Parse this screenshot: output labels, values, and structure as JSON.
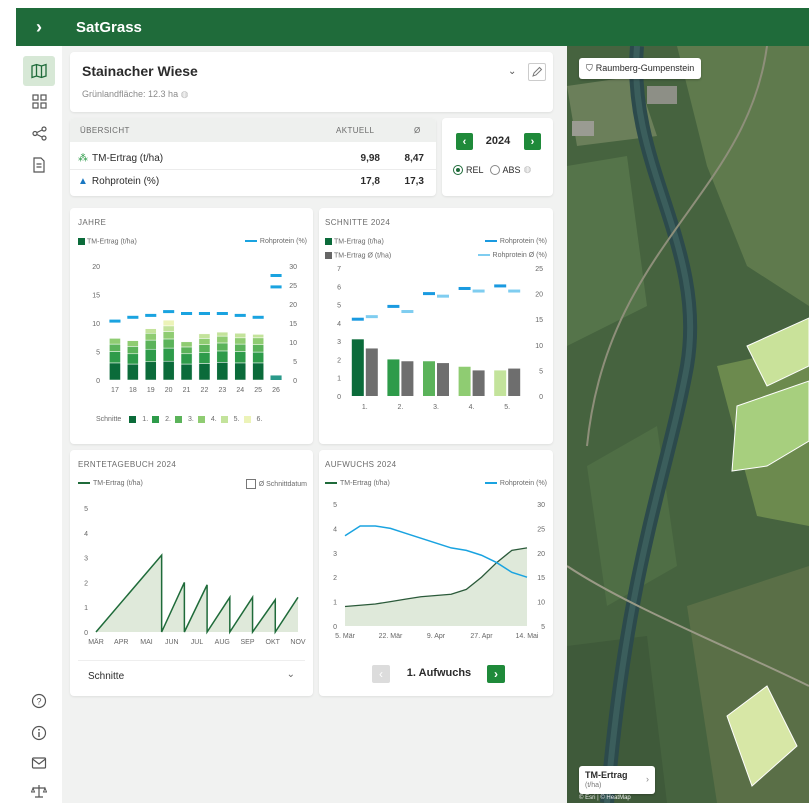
{
  "app": {
    "title": "SatGrass"
  },
  "field": {
    "name": "Stainacher Wiese",
    "area": "Grünlandfläche: 12.3 ha"
  },
  "overview": {
    "title": "ÜBERSICHT",
    "col_current": "AKTUELL",
    "col_avg": "Ø",
    "rows": [
      {
        "label": "TM-Ertrag (t/ha)",
        "current": "9,98",
        "avg": "8,47"
      },
      {
        "label": "Rohprotein (%)",
        "current": "17,8",
        "avg": "17,3"
      }
    ]
  },
  "year_selector": {
    "year": "2024",
    "rel": "REL",
    "abs": "ABS"
  },
  "jahre": {
    "title": "JAHRE",
    "legend_yield": "TM-Ertrag (t/ha)",
    "legend_protein": "Rohprotein (%)",
    "cut_legend_label": "Schnitte",
    "cut_labels": [
      "1.",
      "2.",
      "3.",
      "4.",
      "5.",
      "6."
    ]
  },
  "schnitte": {
    "title": "SCHNITTE 2024",
    "legend_yield": "TM-Ertrag (t/ha)",
    "legend_yield_avg": "TM-Ertrag Ø (t/ha)",
    "legend_protein": "Rohprotein (%)",
    "legend_protein_avg": "Rohprotein Ø (%)"
  },
  "ernte": {
    "title": "ERNTETAGEBUCH 2024",
    "legend_yield": "TM-Ertrag (t/ha)",
    "checkbox_label": "Ø Schnittdatum",
    "dropdown_value": "Schnitte"
  },
  "aufwuchs": {
    "title": "AUFWUCHS 2024",
    "legend_yield": "TM-Ertrag (t/ha)",
    "legend_protein": "Rohprotein (%)",
    "nav_label": "1. Aufwuchs"
  },
  "map": {
    "region_button": "Raumberg-Gumpenstein",
    "layer_label": "TM-Ertrag",
    "layer_unit": "(t/ha)",
    "attribution": "© Esri | © HeatMap"
  },
  "colors": {
    "brand": "#1f6b3a",
    "accent": "#1f8a3a",
    "protein": "#1aa3e0",
    "cut1": "#0b6b3a",
    "cut2": "#2e9b4a",
    "cut3": "#5bb35a",
    "cut4": "#8fcc72",
    "cut5": "#c3e39b",
    "cut6": "#ecf3b8"
  },
  "chart_data": [
    {
      "type": "bar",
      "title": "JAHRE",
      "categories": [
        "17",
        "18",
        "19",
        "20",
        "21",
        "22",
        "23",
        "24",
        "25",
        "26"
      ],
      "series": [
        {
          "name": "1.",
          "values": [
            3.0,
            2.8,
            3.2,
            3.3,
            2.8,
            2.9,
            3.1,
            3.0,
            3.0,
            0
          ]
        },
        {
          "name": "2.",
          "values": [
            2.0,
            1.8,
            2.2,
            2.3,
            1.8,
            1.9,
            2.0,
            2.0,
            1.9,
            0
          ]
        },
        {
          "name": "3.",
          "values": [
            1.3,
            1.3,
            1.6,
            1.6,
            1.2,
            1.4,
            1.4,
            1.3,
            1.3,
            0
          ]
        },
        {
          "name": "4.",
          "values": [
            1.0,
            1.0,
            1.2,
            1.3,
            0.9,
            1.1,
            1.2,
            1.1,
            1.2,
            0
          ]
        },
        {
          "name": "5.",
          "values": [
            0,
            0,
            0.8,
            1.0,
            0,
            0.8,
            0.7,
            0.8,
            0.6,
            0
          ]
        },
        {
          "name": "6.",
          "values": [
            0,
            0,
            0,
            1.0,
            0,
            0,
            0,
            0,
            0,
            0
          ]
        }
      ],
      "extra_bar": {
        "category": "26",
        "value": 0.8
      },
      "protein": {
        "name": "Rohprotein (%)",
        "values": [
          15.5,
          16.5,
          17,
          18,
          17.5,
          17.5,
          17.5,
          17,
          16.5,
          24.5
        ]
      },
      "protein_extra": {
        "category": "26",
        "value": 27.5
      },
      "ylim_left": [
        0,
        20
      ],
      "ylim_right": [
        0,
        30
      ]
    },
    {
      "type": "bar",
      "title": "SCHNITTE 2024",
      "categories": [
        "1.",
        "2.",
        "3.",
        "4.",
        "5."
      ],
      "yield": [
        3.1,
        2.0,
        1.9,
        1.6,
        1.4
      ],
      "yield_avg": [
        2.6,
        1.9,
        1.8,
        1.4,
        1.5
      ],
      "protein": [
        15,
        17.5,
        20,
        21,
        21.5
      ],
      "protein_avg": [
        15.5,
        16.5,
        19.5,
        20.5,
        20.5
      ],
      "ylim_left": [
        0,
        7
      ],
      "ylim_right": [
        0,
        25
      ]
    },
    {
      "type": "area",
      "title": "ERNTETAGEBUCH 2024",
      "x": [
        "MÄR",
        "APR",
        "MAI",
        "JUN",
        "JUL",
        "AUG",
        "SEP",
        "OKT",
        "NOV"
      ],
      "points": [
        [
          0,
          0
        ],
        [
          2.6,
          3.1
        ],
        [
          2.6,
          0
        ],
        [
          3.5,
          2.0
        ],
        [
          3.5,
          0
        ],
        [
          4.4,
          1.9
        ],
        [
          4.4,
          0
        ],
        [
          5.3,
          1.4
        ],
        [
          5.3,
          0
        ],
        [
          6.2,
          1.4
        ],
        [
          6.2,
          0
        ],
        [
          7.1,
          1.3
        ],
        [
          7.1,
          0
        ],
        [
          8.0,
          1.4
        ]
      ],
      "ylim": [
        0,
        5
      ]
    },
    {
      "type": "line",
      "title": "AUFWUCHS 2024",
      "x_ticks": [
        "5. Mär",
        "22. Mär",
        "9. Apr",
        "27. Apr",
        "14. Mai"
      ],
      "yield": [
        0.8,
        0.85,
        0.9,
        1.0,
        1.1,
        1.2,
        1.25,
        1.3,
        1.5,
        2.0,
        2.6,
        3.1,
        3.2
      ],
      "protein": [
        23.5,
        25.5,
        25.5,
        25,
        24,
        23,
        22,
        21,
        20.5,
        19.5,
        18,
        16,
        15
      ],
      "ylim_left": [
        0,
        5
      ],
      "ylim_right": [
        5,
        30
      ]
    }
  ]
}
